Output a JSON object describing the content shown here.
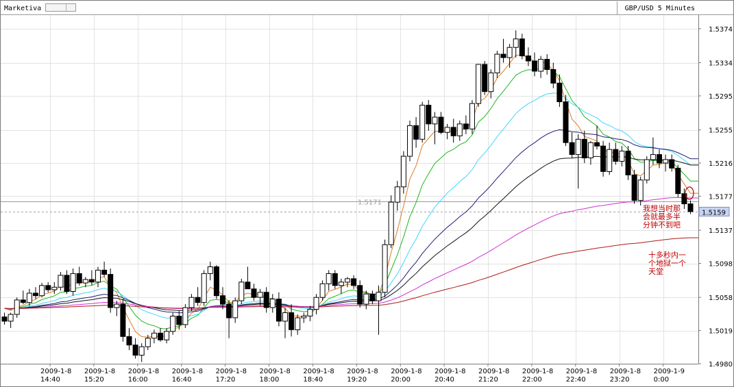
{
  "app": {
    "brand": "Marketiva",
    "symbol_label": "GBP/USD  5 Minutes"
  },
  "colors": {
    "ema_orange": "#e07a1f",
    "ema_green": "#1fb51f",
    "ema_cyan": "#3fd6ff",
    "ema_navy": "#1c1c7a",
    "ema_black": "#111111",
    "ema_magenta": "#d030d0",
    "ema_red": "#b01818",
    "annotation": "#c00000",
    "price_tag": "#c7d4f2"
  },
  "chart_data": {
    "type": "candlestick",
    "ylim": [
      1.498,
      1.539
    ],
    "y_ticks": [
      "1.5374",
      "1.5334",
      "1.5295",
      "1.5255",
      "1.5216",
      "1.5177",
      "1.5137",
      "1.5098",
      "1.5058",
      "1.5019",
      "1.4980"
    ],
    "x_ticks": [
      {
        "date": "2009-1-8",
        "time": "14:40"
      },
      {
        "date": "2009-1-8",
        "time": "15:20"
      },
      {
        "date": "2009-1-8",
        "time": "16:00"
      },
      {
        "date": "2009-1-8",
        "time": "16:40"
      },
      {
        "date": "2009-1-8",
        "time": "17:20"
      },
      {
        "date": "2009-1-8",
        "time": "18:00"
      },
      {
        "date": "2009-1-8",
        "time": "18:40"
      },
      {
        "date": "2009-1-8",
        "time": "19:20"
      },
      {
        "date": "2009-1-8",
        "time": "20:00"
      },
      {
        "date": "2009-1-8",
        "time": "20:40"
      },
      {
        "date": "2009-1-8",
        "time": "21:20"
      },
      {
        "date": "2009-1-8",
        "time": "22:00"
      },
      {
        "date": "2009-1-8",
        "time": "22:40"
      },
      {
        "date": "2009-1-8",
        "time": "23:20"
      },
      {
        "date": "2009-1-9",
        "time": "0:00"
      }
    ],
    "reference_line": {
      "value": 1.5171,
      "label": "1.5171"
    },
    "current_price": {
      "value": 1.5159,
      "label": "1.5159"
    },
    "grid": true,
    "candles": [
      [
        1.5035,
        1.504,
        1.5026,
        1.503
      ],
      [
        1.503,
        1.504,
        1.5022,
        1.5038
      ],
      [
        1.5038,
        1.5058,
        1.5034,
        1.5055
      ],
      [
        1.5055,
        1.5066,
        1.505,
        1.5052
      ],
      [
        1.5052,
        1.5068,
        1.5048,
        1.5063
      ],
      [
        1.5063,
        1.507,
        1.5056,
        1.506
      ],
      [
        1.506,
        1.5075,
        1.5058,
        1.5072
      ],
      [
        1.5072,
        1.5076,
        1.5064,
        1.5067
      ],
      [
        1.5067,
        1.5076,
        1.5062,
        1.507
      ],
      [
        1.507,
        1.5088,
        1.5066,
        1.5084
      ],
      [
        1.5084,
        1.509,
        1.5062,
        1.5065
      ],
      [
        1.5065,
        1.5092,
        1.506,
        1.5086
      ],
      [
        1.5086,
        1.5094,
        1.5072,
        1.5075
      ],
      [
        1.5075,
        1.5082,
        1.507,
        1.5079
      ],
      [
        1.5079,
        1.509,
        1.5072,
        1.5076
      ],
      [
        1.5076,
        1.5094,
        1.507,
        1.509
      ],
      [
        1.509,
        1.51,
        1.5082,
        1.5085
      ],
      [
        1.5085,
        1.5092,
        1.504,
        1.5046
      ],
      [
        1.5046,
        1.5054,
        1.5036,
        1.505
      ],
      [
        1.505,
        1.5056,
        1.5006,
        1.5012
      ],
      [
        1.5012,
        1.5022,
        1.4996,
        1.5002
      ],
      [
        1.5002,
        1.501,
        1.4986,
        1.499
      ],
      [
        1.499,
        1.5004,
        1.4982,
        1.5
      ],
      [
        1.5,
        1.5014,
        1.4996,
        1.501
      ],
      [
        1.501,
        1.502,
        1.5004,
        1.5016
      ],
      [
        1.5016,
        1.5022,
        1.5006,
        1.5008
      ],
      [
        1.5008,
        1.5022,
        1.5004,
        1.5018
      ],
      [
        1.5018,
        1.504,
        1.5014,
        1.5036
      ],
      [
        1.5036,
        1.5042,
        1.502,
        1.5026
      ],
      [
        1.5026,
        1.505,
        1.5022,
        1.5046
      ],
      [
        1.5046,
        1.5062,
        1.5042,
        1.5058
      ],
      [
        1.5058,
        1.507,
        1.5048,
        1.5052
      ],
      [
        1.5052,
        1.509,
        1.5048,
        1.5086
      ],
      [
        1.5086,
        1.51,
        1.5078,
        1.5094
      ],
      [
        1.5094,
        1.5096,
        1.5056,
        1.506
      ],
      [
        1.506,
        1.507,
        1.5044,
        1.505
      ],
      [
        1.505,
        1.5055,
        1.501,
        1.5034
      ],
      [
        1.5034,
        1.5058,
        1.5028,
        1.5054
      ],
      [
        1.5054,
        1.508,
        1.505,
        1.5076
      ],
      [
        1.5076,
        1.5094,
        1.507,
        1.5068
      ],
      [
        1.5068,
        1.5074,
        1.5054,
        1.5058
      ],
      [
        1.5058,
        1.5068,
        1.5048,
        1.5064
      ],
      [
        1.5064,
        1.507,
        1.504,
        1.5046
      ],
      [
        1.5046,
        1.5062,
        1.504,
        1.5056
      ],
      [
        1.5056,
        1.5064,
        1.5024,
        1.503
      ],
      [
        1.503,
        1.5046,
        1.501,
        1.504
      ],
      [
        1.504,
        1.505,
        1.5012,
        1.502
      ],
      [
        1.502,
        1.5038,
        1.5014,
        1.5034
      ],
      [
        1.5034,
        1.504,
        1.5028,
        1.5036
      ],
      [
        1.5036,
        1.5048,
        1.503,
        1.5044
      ],
      [
        1.5044,
        1.5062,
        1.5038,
        1.5058
      ],
      [
        1.5058,
        1.5078,
        1.5054,
        1.5074
      ],
      [
        1.5074,
        1.509,
        1.5066,
        1.5086
      ],
      [
        1.5086,
        1.509,
        1.5068,
        1.5072
      ],
      [
        1.5072,
        1.508,
        1.5062,
        1.5076
      ],
      [
        1.5076,
        1.5082,
        1.507,
        1.508
      ],
      [
        1.508,
        1.5084,
        1.5068,
        1.5072
      ],
      [
        1.5072,
        1.5078,
        1.5046,
        1.505
      ],
      [
        1.505,
        1.5066,
        1.5044,
        1.5062
      ],
      [
        1.5062,
        1.5066,
        1.505,
        1.5054
      ],
      [
        1.5054,
        1.5072,
        1.5014,
        1.5064
      ],
      [
        1.5064,
        1.5126,
        1.5058,
        1.512
      ],
      [
        1.512,
        1.5178,
        1.5116,
        1.517
      ],
      [
        1.517,
        1.5195,
        1.516,
        1.5188
      ],
      [
        1.5188,
        1.523,
        1.518,
        1.5224
      ],
      [
        1.5224,
        1.5266,
        1.5218,
        1.526
      ],
      [
        1.526,
        1.527,
        1.5234,
        1.5244
      ],
      [
        1.5244,
        1.5288,
        1.524,
        1.5284
      ],
      [
        1.5284,
        1.529,
        1.5254,
        1.5262
      ],
      [
        1.5262,
        1.5276,
        1.5238,
        1.527
      ],
      [
        1.527,
        1.5276,
        1.525,
        1.5252
      ],
      [
        1.5252,
        1.5262,
        1.5244,
        1.5258
      ],
      [
        1.5258,
        1.5268,
        1.524,
        1.5248
      ],
      [
        1.5248,
        1.5266,
        1.5242,
        1.5262
      ],
      [
        1.5262,
        1.5272,
        1.525,
        1.5256
      ],
      [
        1.5256,
        1.529,
        1.525,
        1.5286
      ],
      [
        1.5286,
        1.532,
        1.5282,
        1.5332
      ],
      [
        1.5332,
        1.5336,
        1.5296,
        1.53
      ],
      [
        1.53,
        1.5326,
        1.5292,
        1.5322
      ],
      [
        1.5322,
        1.5348,
        1.5316,
        1.5344
      ],
      [
        1.5344,
        1.5362,
        1.5334,
        1.534
      ],
      [
        1.534,
        1.5356,
        1.5328,
        1.5352
      ],
      [
        1.5352,
        1.5372,
        1.534,
        1.5362
      ],
      [
        1.5362,
        1.5368,
        1.5338,
        1.5342
      ],
      [
        1.5342,
        1.5352,
        1.533,
        1.5336
      ],
      [
        1.5336,
        1.5346,
        1.5318,
        1.5324
      ],
      [
        1.5324,
        1.5342,
        1.5316,
        1.5338
      ],
      [
        1.5338,
        1.5344,
        1.532,
        1.5326
      ],
      [
        1.5326,
        1.5334,
        1.5304,
        1.531
      ],
      [
        1.531,
        1.532,
        1.5282,
        1.5288
      ],
      [
        1.5288,
        1.5296,
        1.5236,
        1.524
      ],
      [
        1.524,
        1.5252,
        1.5222,
        1.5226
      ],
      [
        1.5226,
        1.525,
        1.5186,
        1.5244
      ],
      [
        1.5244,
        1.5254,
        1.5216,
        1.5222
      ],
      [
        1.5222,
        1.5242,
        1.5214,
        1.524
      ],
      [
        1.524,
        1.526,
        1.5232,
        1.5236
      ],
      [
        1.5236,
        1.5242,
        1.52,
        1.5206
      ],
      [
        1.5206,
        1.524,
        1.5202,
        1.5232
      ],
      [
        1.5232,
        1.524,
        1.5214,
        1.5218
      ],
      [
        1.5218,
        1.5236,
        1.5212,
        1.523
      ],
      [
        1.523,
        1.5236,
        1.5196,
        1.5202
      ],
      [
        1.5202,
        1.5208,
        1.5168,
        1.5172
      ],
      [
        1.5172,
        1.52,
        1.5166,
        1.5196
      ],
      [
        1.5196,
        1.5224,
        1.5192,
        1.522
      ],
      [
        1.522,
        1.5246,
        1.5214,
        1.5226
      ],
      [
        1.5226,
        1.5232,
        1.521,
        1.5216
      ],
      [
        1.5216,
        1.5226,
        1.5206,
        1.522
      ],
      [
        1.522,
        1.5226,
        1.5206,
        1.521
      ],
      [
        1.521,
        1.5214,
        1.5176,
        1.518
      ],
      [
        1.518,
        1.5186,
        1.5162,
        1.5168
      ],
      [
        1.5168,
        1.5172,
        1.5156,
        1.5159
      ]
    ],
    "moving_averages": [
      {
        "color": "#e07a1f",
        "period": 5
      },
      {
        "color": "#1fb51f",
        "period": 10
      },
      {
        "color": "#3fd6ff",
        "period": 20
      },
      {
        "color": "#1c1c7a",
        "period": 35
      },
      {
        "color": "#111111",
        "period": 50
      },
      {
        "color": "#d030d0",
        "period": 100
      },
      {
        "color": "#b01818",
        "period": 200
      }
    ],
    "annotations": [
      {
        "lines": [
          "我想当时那",
          "会就最多半",
          "分钟不到吧"
        ]
      },
      {
        "lines": [
          "十多秒内一",
          "个地狱一个",
          "天堂"
        ]
      }
    ]
  }
}
